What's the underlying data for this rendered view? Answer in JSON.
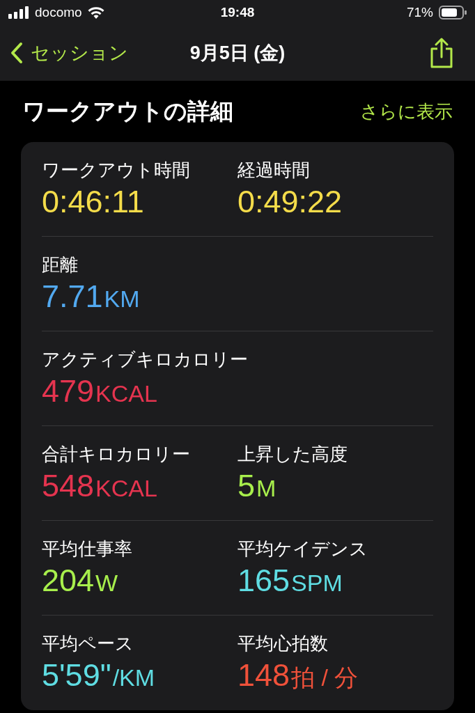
{
  "status_bar": {
    "carrier": "docomo",
    "time": "19:48",
    "battery": "71%"
  },
  "nav": {
    "back": "セッション",
    "title": "9月5日 (金)"
  },
  "section": {
    "title": "ワークアウトの詳細",
    "more": "さらに表示"
  },
  "rows": [
    {
      "items": [
        {
          "label": "ワークアウト時間",
          "value": "0:46:11",
          "color": "#f4dc4a"
        },
        {
          "label": "経過時間",
          "value": "0:49:22",
          "color": "#f4dc4a"
        }
      ]
    },
    {
      "items": [
        {
          "label": "距離",
          "value": "7.71",
          "unit": "KM",
          "color": "#52a9f0"
        }
      ]
    },
    {
      "items": [
        {
          "label": "アクティブキロカロリー",
          "value": "479",
          "unit": "KCAL",
          "color": "#e5344f"
        }
      ]
    },
    {
      "items": [
        {
          "label": "合計キロカロリー",
          "value": "548",
          "unit": "KCAL",
          "color": "#e5344f"
        },
        {
          "label": "上昇した高度",
          "value": "5",
          "unit": "M",
          "color": "#a8ef4c"
        }
      ]
    },
    {
      "items": [
        {
          "label": "平均仕事率",
          "value": "204",
          "unit": "W",
          "color": "#a8ef4c"
        },
        {
          "label": "平均ケイデンス",
          "value": "165",
          "unit": "SPM",
          "color": "#5fdde3"
        }
      ]
    },
    {
      "items": [
        {
          "label": "平均ペース",
          "value": "5'59\"",
          "unit": "/KM",
          "color": "#5fdde3"
        },
        {
          "label": "平均心拍数",
          "value": "148",
          "unit": "拍 / 分",
          "color": "#f0513a"
        }
      ]
    }
  ]
}
